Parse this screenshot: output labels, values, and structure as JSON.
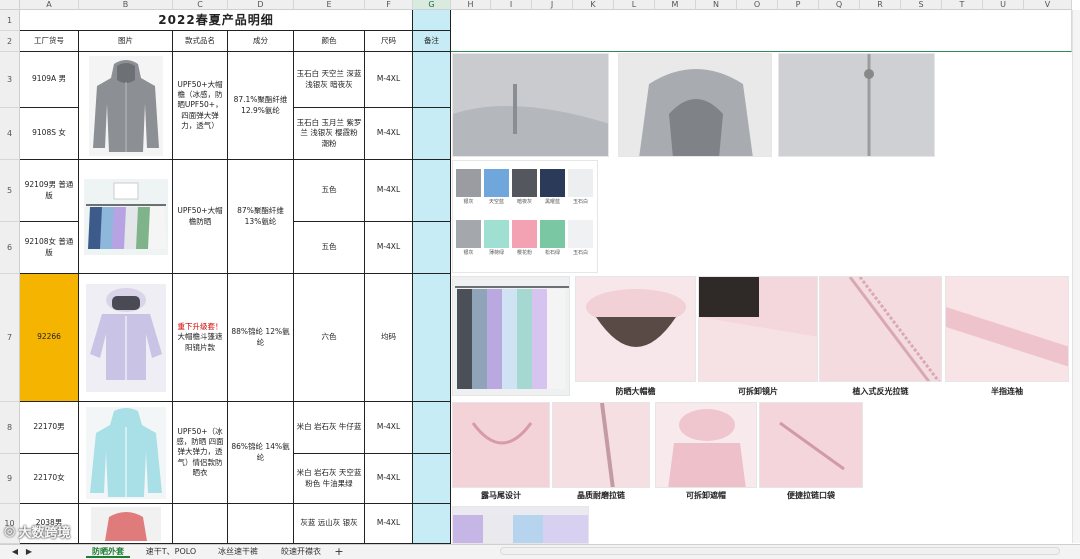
{
  "sheet": {
    "columns": [
      "A",
      "B",
      "C",
      "D",
      "E",
      "F",
      "G",
      "H",
      "I",
      "J",
      "K",
      "L",
      "M",
      "N",
      "O",
      "P",
      "Q",
      "R",
      "S",
      "T",
      "U",
      "V"
    ],
    "rows": [
      "1",
      "2",
      "3",
      "4",
      "5",
      "6",
      "7",
      "8",
      "9",
      "10"
    ],
    "title": "2022春夏产品明细",
    "headers": {
      "factory_no": "工厂货号",
      "picture": "图片",
      "style_name": "款式品名",
      "composition": "成分",
      "color": "颜色",
      "size": "尺码",
      "note": "备注"
    },
    "records": [
      {
        "factory_no": "9109A 男",
        "style_name": "UPF50+大帽檐（冰感，防晒UPF50+，四面弹大弹力，透气）",
        "composition": "87.1%聚酯纤维 12.9%氨纶",
        "color": "玉石白 天空兰 深蓝 浅银灰 暗夜灰",
        "size": "M-4XL"
      },
      {
        "factory_no": "9108S 女",
        "color": "玉石白 玉月兰 紫罗兰 浅银灰 樱霞粉 潮粉",
        "size": "M-4XL"
      },
      {
        "factory_no": "92109男   普通版",
        "style_name": "UPF50+大帽檐防晒",
        "composition": "87%聚酯纤维 13%氨纶",
        "color": "五色",
        "size": "M-4XL"
      },
      {
        "factory_no": "92108女 普通版",
        "color": "五色",
        "size": "M-4XL"
      },
      {
        "factory_no": "92266",
        "style_name_red": "重下升级套！",
        "style_name": "大帽檐斗篷遮阳镜片款",
        "composition": "88%锦纶 12%氨纶",
        "color": "六色",
        "size": "均码"
      },
      {
        "factory_no": "22170男",
        "style_name": "UPF50+（冰感，防晒 四面弹大弹力，透气）情侣款防晒衣",
        "composition": "86%锦纶 14%氨纶",
        "color": "米白 岩石灰 牛仔蓝",
        "size": "M-4XL"
      },
      {
        "factory_no": "22170女",
        "color": "米白 岩石灰 天空蓝 粉色 牛油果绿",
        "size": "M-4XL"
      },
      {
        "factory_no": "2038男",
        "color": "灰蓝 远山灰 银灰",
        "size": "M-4XL"
      }
    ],
    "captions": [
      "防晒大帽檐",
      "可拆卸镜片",
      "植入式反光拉链",
      "半指连袖",
      "露马尾设计",
      "晶质耐磨拉链",
      "可拆卸遮帽",
      "便捷拉链口袋"
    ],
    "swatch_labels_row1": [
      "银灰",
      "天空蓝",
      "暗夜灰",
      "黑曜蓝",
      "玉石白"
    ],
    "swatch_labels_row2": [
      "银灰",
      "薄荷绿",
      "樱花粉",
      "松石绿",
      "玉石白"
    ]
  },
  "tabs": [
    "防晒外套",
    "速干T、POLO",
    "冰丝速干裤",
    "皎速开襟衣"
  ],
  "add_sheet": "+",
  "watermark": "大数跨境",
  "colors": {
    "accent": "#1e7e34",
    "highlight": "#f4b400",
    "note_column": "#c8ecf6",
    "red_text": "#d00000"
  }
}
